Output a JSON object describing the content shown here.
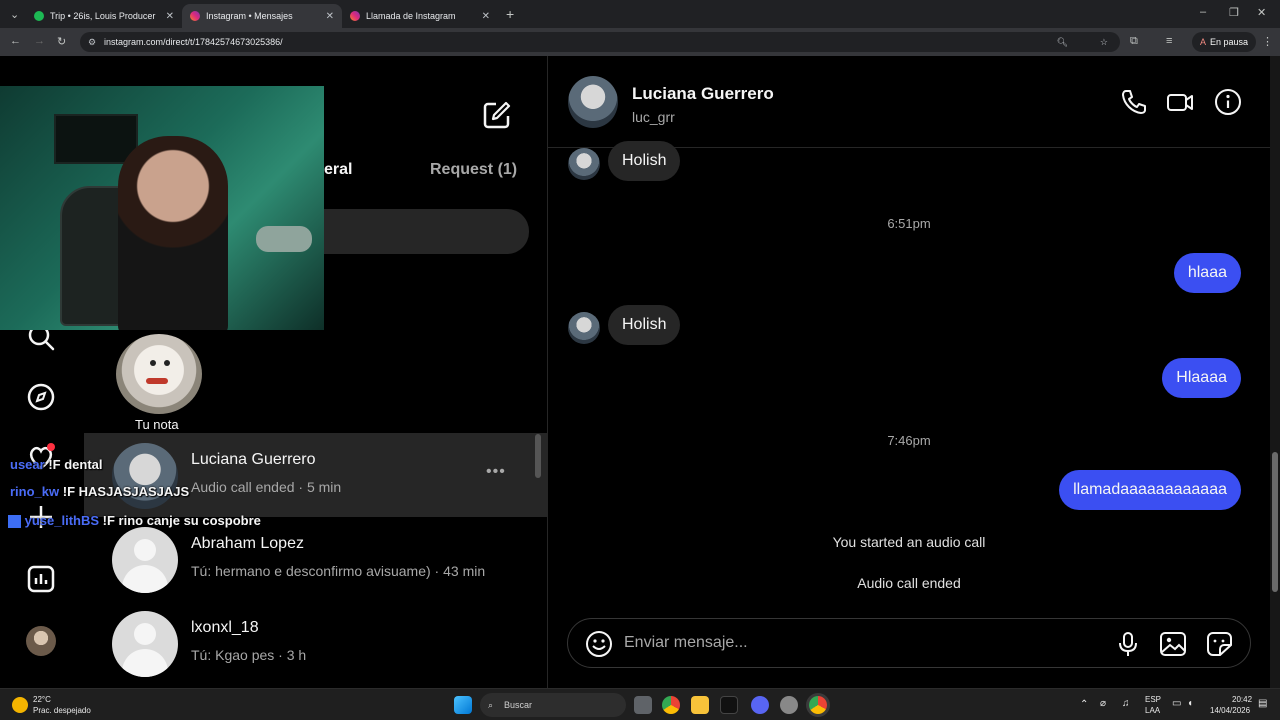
{
  "browser": {
    "tabs": [
      {
        "label": "Trip • 26is, Louis Producer",
        "active": false
      },
      {
        "label": "Instagram • Mensajes",
        "active": true
      },
      {
        "label": "Llamada de Instagram",
        "active": false
      }
    ],
    "url": "instagram.com/direct/t/17842574673025386/",
    "profile_initial": "A",
    "profile_status": "En pausa"
  },
  "inbox": {
    "tab_general": "eral",
    "tab_requests": "Request (1)",
    "note_label": "Tu nota",
    "threads": [
      {
        "name": "Luciana Guerrero",
        "preview": "Audio call ended · 5 min",
        "selected": true
      },
      {
        "name": "Abraham Lopez",
        "preview": "Tú: hermano e desconfirmo avisuame) · 43 min",
        "selected": false
      },
      {
        "name": "lxonxl_18",
        "preview": "Tú: Kgao pes · 3 h",
        "selected": false
      }
    ]
  },
  "stream_chat": [
    {
      "user": "usear",
      "text": "!F dental"
    },
    {
      "user": "rino_kw",
      "text": "!F HASJASJASJAJS"
    },
    {
      "user": "yuse_lithBS",
      "text": "!F rino canje su cospobre"
    }
  ],
  "chat": {
    "name": "Luciana Guerrero",
    "username": "luc_grr",
    "messages": [
      {
        "type": "in",
        "text": "Holish"
      },
      {
        "type": "time",
        "text": "6:51pm"
      },
      {
        "type": "out",
        "text": "hlaaa"
      },
      {
        "type": "in",
        "text": "Holish"
      },
      {
        "type": "out",
        "text": "Hlaaaa"
      },
      {
        "type": "time",
        "text": "7:46pm"
      },
      {
        "type": "out",
        "text": "llamadaaaaaaaaaaaa"
      },
      {
        "type": "system",
        "text": "You started an audio call"
      },
      {
        "type": "system",
        "text": "Audio call ended"
      }
    ],
    "composer_placeholder": "Enviar mensaje..."
  },
  "taskbar": {
    "weather_temp": "22°C",
    "weather_desc": "Prac. despejado",
    "search_label": "Buscar",
    "lang_top": "ESP",
    "lang_bottom": "LAA",
    "time": "20:42",
    "date": "14/04/2026"
  },
  "colors": {
    "accent_blue": "#3b4ff2",
    "bg": "#000000",
    "bubble_in": "#262626"
  }
}
